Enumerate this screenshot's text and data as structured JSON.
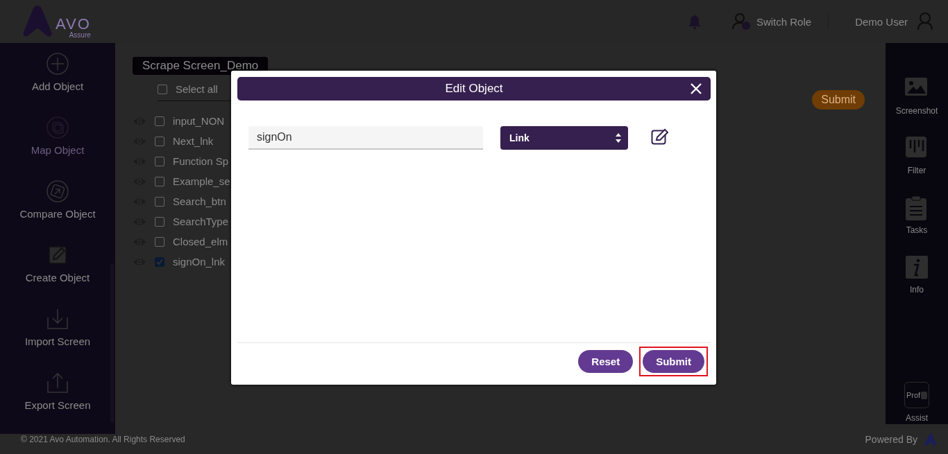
{
  "header": {
    "logo_text": "AVO",
    "logo_subtext": "Assure",
    "switch_role": "Switch Role",
    "user_name": "Demo User"
  },
  "left_sidebar": {
    "items": [
      {
        "label": "Add Object",
        "disabled": false
      },
      {
        "label": "Map Object",
        "disabled": true
      },
      {
        "label": "Compare Object",
        "disabled": false
      },
      {
        "label": "Create Object",
        "disabled": false
      },
      {
        "label": "Import Screen",
        "disabled": false
      },
      {
        "label": "Export Screen",
        "disabled": false
      }
    ]
  },
  "screen_tag": "Scrape Screen_Demo",
  "select_all": {
    "label": "Select all",
    "checked": false
  },
  "objects": [
    {
      "label": "input_NON",
      "checked": false
    },
    {
      "label": "Next_lnk",
      "checked": false
    },
    {
      "label": "Function Sp",
      "checked": false
    },
    {
      "label": "Example_se",
      "checked": false
    },
    {
      "label": "Search_btn",
      "checked": false
    },
    {
      "label": "SearchType",
      "checked": false
    },
    {
      "label": "Closed_elm",
      "checked": false
    },
    {
      "label": "signOn_lnk",
      "checked": true
    }
  ],
  "background_submit": "Submit",
  "right_sidebar": {
    "items": [
      {
        "label": "Screenshot"
      },
      {
        "label": "Filter"
      },
      {
        "label": "Tasks"
      },
      {
        "label": "Info"
      },
      {
        "label": "Assist",
        "icon_text": "Prof"
      }
    ]
  },
  "footer": {
    "copyright": "© 2021 Avo Automation. All Rights Reserved",
    "powered_by": "Powered By"
  },
  "dialog": {
    "title": "Edit Object",
    "name_value": "signOn",
    "type_value": "Link",
    "buttons": [
      {
        "label": "Reset",
        "highlighted": false
      },
      {
        "label": "Submit",
        "highlighted": true
      }
    ]
  }
}
